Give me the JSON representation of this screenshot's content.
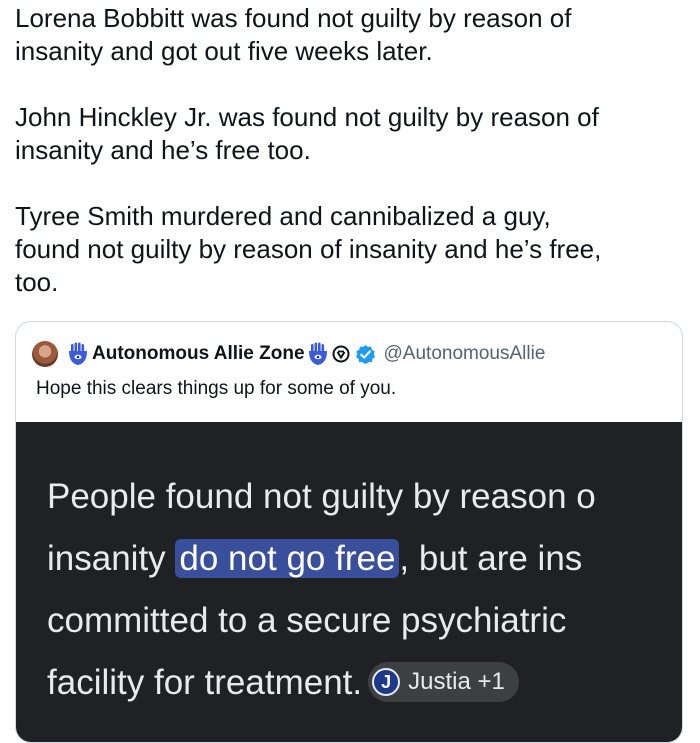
{
  "tweet": {
    "paragraphs": [
      [
        "Lorena Bobbitt was found not guilty by reason of",
        "insanity and got out five weeks later."
      ],
      [
        "John Hinckley Jr. was found not guilty by reason of",
        "insanity and he’s free too."
      ],
      [
        "Tyree Smith murdered and cannibalized a guy,",
        "found not guilty by reason of insanity and he’s free,",
        "too."
      ]
    ]
  },
  "quote": {
    "display_name": "Autonomous Allie Zone",
    "handle": "@AutonomousAllie",
    "text": "Hope this clears things up for some of you.",
    "icons": [
      "avatar",
      "hamsa-icon",
      "hamsa-icon",
      "circle-badge-icon",
      "verified-badge-icon"
    ],
    "screenshot": {
      "line1": "People found not guilty by reason o",
      "line2_before": "insanity ",
      "line2_highlight": "do not go free",
      "line2_after": ", but are ins",
      "line3": "committed to a secure psychiatric",
      "line4": "facility for treatment.",
      "source_icon_letter": "J",
      "source_label": "Justia +1",
      "highlight_color": "#394f9b",
      "background_color": "#202124"
    }
  }
}
